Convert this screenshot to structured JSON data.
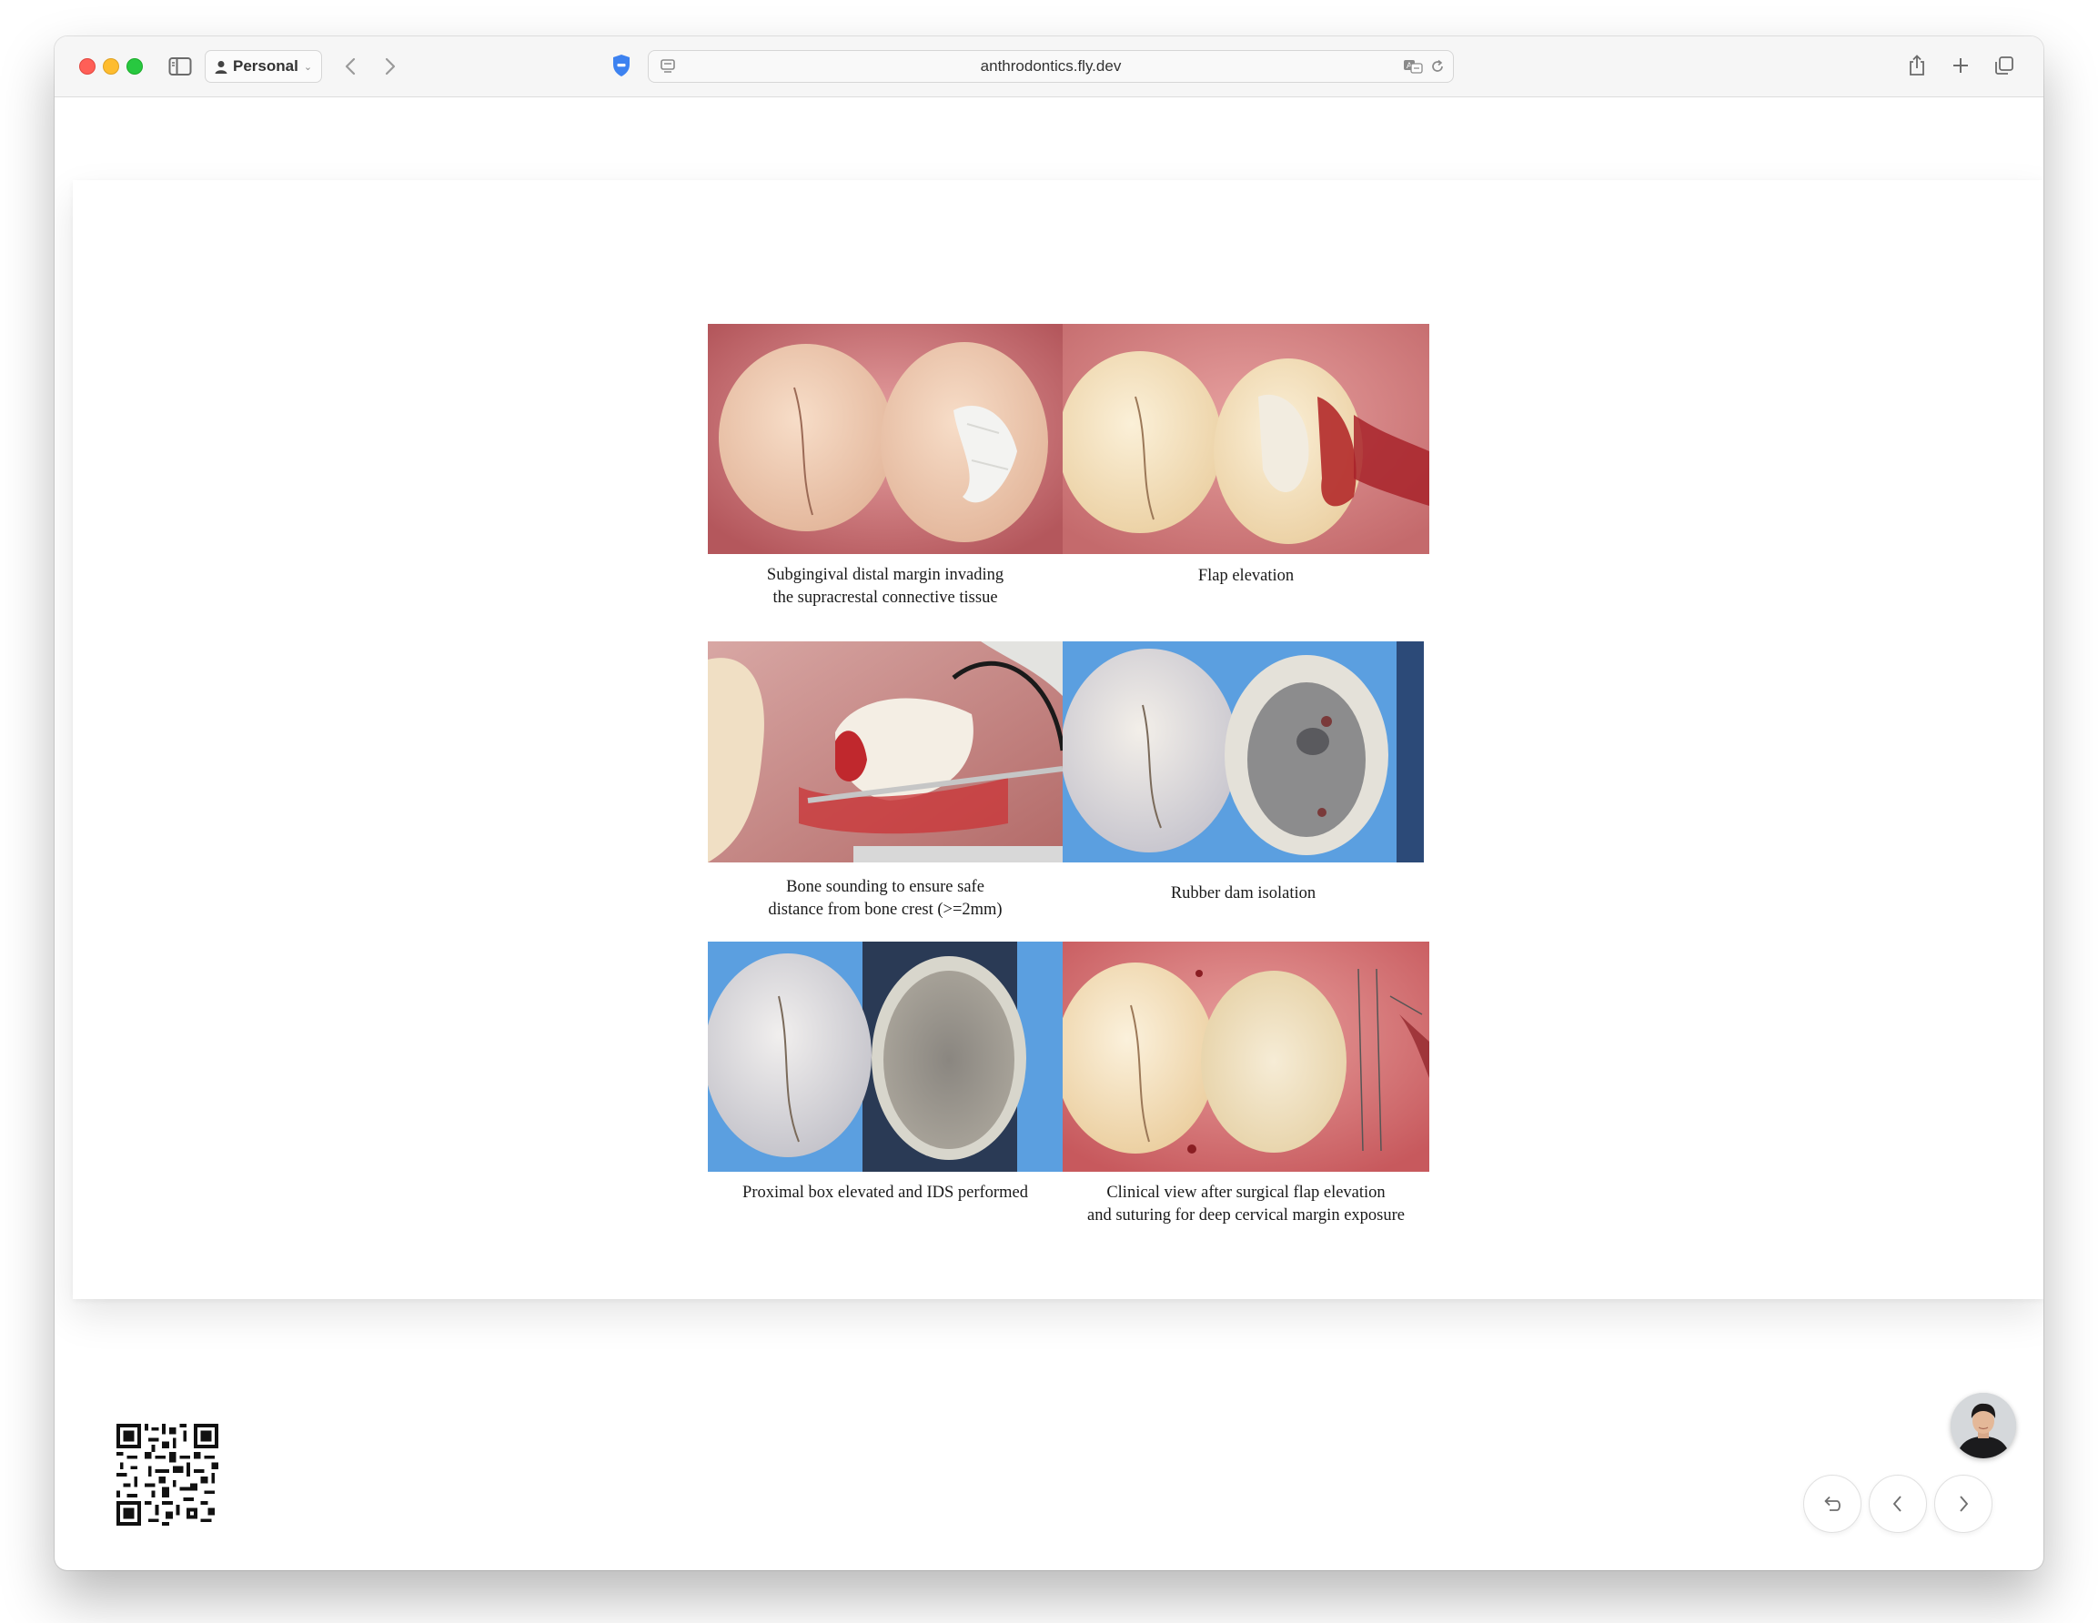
{
  "browser": {
    "profile_label": "Personal",
    "url": "anthrodontics.fly.dev"
  },
  "slide": {
    "captions": {
      "p1_line1": "Subgingival distal margin invading",
      "p1_line2": "the supracrestal connective tissue",
      "p2": "Flap elevation",
      "p3_line1": "Bone sounding to ensure safe",
      "p3_line2": "distance from bone crest (>=2mm)",
      "p4": "Rubber dam isolation",
      "p5": "Proximal box elevated and IDS performed",
      "p6_line1": "Clinical view after surgical flap elevation",
      "p6_line2": "and suturing for deep cervical margin exposure"
    }
  },
  "icons": {
    "sidebar": "sidebar-icon",
    "back": "chevron-left-icon",
    "forward": "chevron-right-icon",
    "shield": "shield-icon",
    "reader": "reader-icon",
    "translate": "translate-icon",
    "reload": "reload-icon",
    "share": "share-icon",
    "new_tab": "plus-icon",
    "tabs": "tabs-overview-icon",
    "undo": "undo-icon",
    "prev": "chevron-left-icon",
    "next": "chevron-right-icon"
  },
  "colors": {
    "gingiva": "#d9878a",
    "rubber_dam": "#5b9fe0",
    "tooth": "#f1e6d6",
    "blood": "#b32a2a",
    "traffic_red": "#ff5f57",
    "traffic_yellow": "#febc2e",
    "traffic_green": "#28c840",
    "shield_blue": "#3d82f0"
  }
}
